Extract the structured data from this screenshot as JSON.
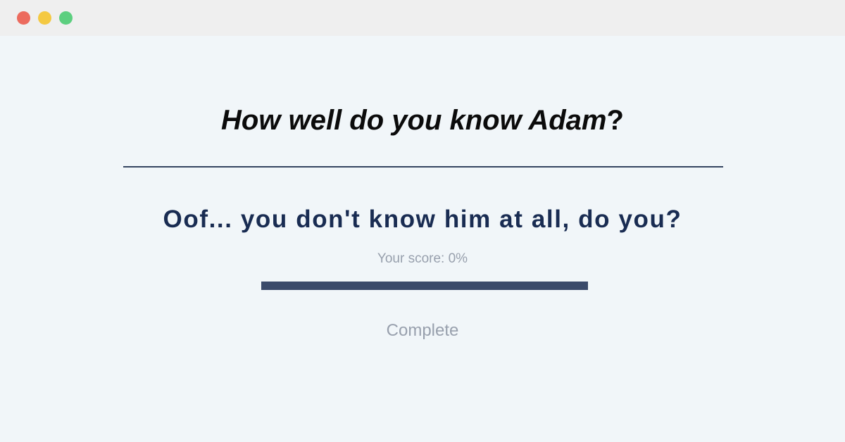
{
  "window": {
    "controls": [
      "close",
      "minimize",
      "maximize"
    ]
  },
  "quiz": {
    "title_main": "How well do you know Adam",
    "title_suffix": "?",
    "result_message": "Oof... you don't know him at all, do you?",
    "score_text": "Your score: 0%",
    "score_fraction": 0,
    "status": "Complete"
  },
  "colors": {
    "background": "#f1f6f9",
    "titlebar": "#efefef",
    "heading": "#0b0b0b",
    "result": "#192c52",
    "muted": "#98a0ad",
    "bar": "#3a4a6a",
    "divider": "#344460",
    "close_dot": "#ec6b5e",
    "minimize_dot": "#f4c942",
    "maximize_dot": "#5ccf7f"
  }
}
